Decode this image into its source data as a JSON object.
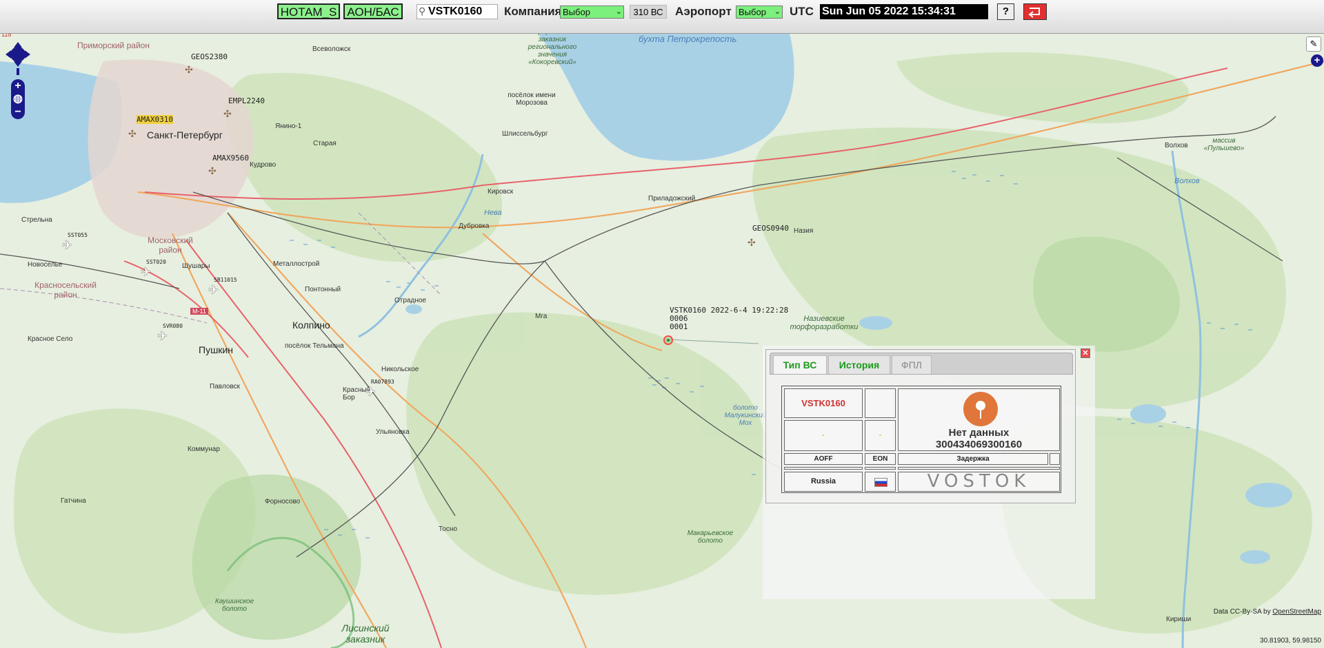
{
  "toolbar": {
    "notam_label": "НОТАМ_S",
    "aon_label": "АОН/БАС",
    "search_value": "VSTK0160",
    "company_label": "Компания",
    "company_select": "Выбор",
    "aircraft_count": "310 ВС",
    "airport_label": "Аэропорт",
    "airport_select": "Выбор",
    "utc_label": "UTC",
    "clock": "Sun Jun 05 2022 15:34:31",
    "help_label": "?",
    "exit_icon": "return-arrow-icon",
    "colors": {
      "toggle_bg": "#8df08d",
      "exit_bg": "#e03030"
    }
  },
  "map": {
    "places": {
      "primorsky": "Приморский район",
      "vsevolozhsk": "Всеволожск",
      "spb": "Санкт-Петербург",
      "kudrovo": "Кудрово",
      "yanino": "Янино-1",
      "staraya": "Старая",
      "strelna": "Стрельна",
      "novoselye": "Новоселье",
      "krasnoselsky": "Красносельский район",
      "moskovsky": "Московский район",
      "shushary": "Шушары",
      "metallostroy": "Металлострой",
      "pontonny": "Понтонный",
      "kolpino": "Колпино",
      "krasnoe_selo": "Красное Село",
      "pushkin": "Пушкин",
      "telmana": "посёлок Тельмана",
      "pavlovsk": "Павловск",
      "nikolskoe": "Никольское",
      "krasny_bor": "Красный Бор",
      "ulyanovka": "Ульяновка",
      "kommunar": "Коммунар",
      "gatchina": "Гатчина",
      "fornosovo": "Форносово",
      "tosno": "Тосно",
      "otradnoe": "Отрадное",
      "mga": "Мга",
      "kirovsk": "Кировск",
      "dubrovka": "Дубровка",
      "neva": "Нева",
      "shlisselburg": "Шлиссельбург",
      "morozova": "посёлок имени Морозова",
      "bay": "бухта Петрокрепость",
      "zakaznik": "природный заказник регионального значения «Кокоревский»",
      "priladozhsky": "Приладожский",
      "naziya": "Назия",
      "nazievskie": "Назиевские торфоразработки",
      "volkhov": "Волхов",
      "volkhov_river": "Волхов",
      "pulyshevo": "массив «Пульшево»",
      "kirishi": "Кириши",
      "malukinsky": "болото Малукинский Мох",
      "makaryevskoe": "Макарьевское болото",
      "kaushtinskoe": "Каушинское болото",
      "lisinsky": "Лисинский заказник",
      "m11": "М-11",
      "scale_tag": "118"
    },
    "aircraft_labels": {
      "geos2380": "GEOS2380",
      "empl2240": "EMPL2240",
      "amax9560": "AMAX9560",
      "amax0310": "AMAX0310",
      "geos0940": "GEOS0940",
      "sst055": "SST055",
      "sst020": "SST020",
      "sb11015": "SB11015",
      "svr080": "SVR080",
      "ra07893": "RA07893"
    },
    "track": {
      "label": "VSTK0160 2022-6-4 19:22:28\n0006\n0001"
    },
    "controls": {
      "zoom_in": "+",
      "zoom_out": "−",
      "plus": "+"
    },
    "attribution_prefix": "Data CC-By-SA by ",
    "attribution_link": "OpenStreetMap",
    "coords": "30.81903, 59.98150"
  },
  "popup": {
    "close": "✕",
    "tabs": [
      "Тип ВС",
      "История",
      "ФПЛ"
    ],
    "callsign": "VSTK0160",
    "dash1": "-",
    "dash2": "-",
    "no_data": "Нет данных",
    "imei": "300434069300160",
    "h_aoff": "AOFF",
    "h_eon": "EON",
    "h_delay": "Задержка",
    "country": "Russia",
    "logo": "VOSTOK"
  }
}
